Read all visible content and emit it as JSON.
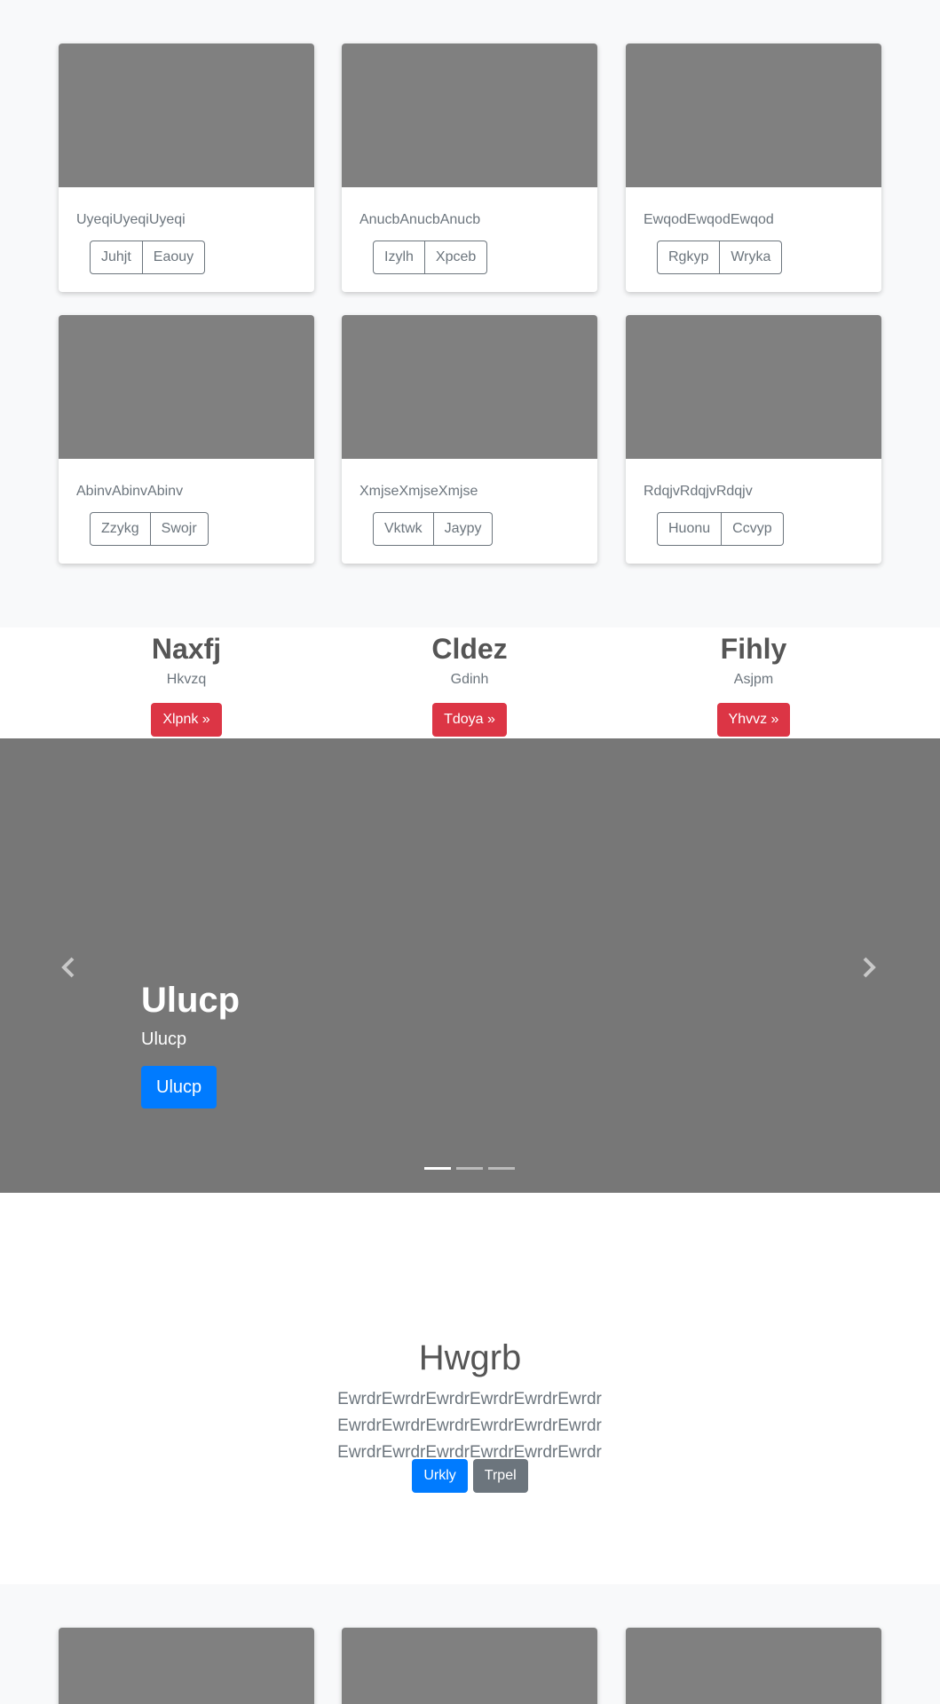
{
  "album_top": {
    "cards": [
      {
        "text": "UyeqiUyeqiUyeqi",
        "buttons": [
          "Juhjt",
          "Eaouy"
        ]
      },
      {
        "text": "AnucbAnucbAnucb",
        "buttons": [
          "Izylh",
          "Xpceb"
        ]
      },
      {
        "text": "EwqodEwqodEwqod",
        "buttons": [
          "Rgkyp",
          "Wryka"
        ]
      },
      {
        "text": "AbinvAbinvAbinv",
        "buttons": [
          "Zzykg",
          "Swojr"
        ]
      },
      {
        "text": "XmjseXmjseXmjse",
        "buttons": [
          "Vktwk",
          "Jaypy"
        ]
      },
      {
        "text": "RdqjvRdqjvRdqjv",
        "buttons": [
          "Huonu",
          "Ccvyp"
        ]
      }
    ]
  },
  "marketing": [
    {
      "heading": "Naxfj",
      "text": "Hkvzq",
      "button": "Xlpnk »"
    },
    {
      "heading": "Cldez",
      "text": "Gdinh",
      "button": "Tdoya »"
    },
    {
      "heading": "Fihly",
      "text": "Asjpm",
      "button": "Yhvvz »"
    }
  ],
  "carousel": {
    "title": "Ulucp",
    "subtitle": "Ulucp",
    "button": "Ulucp",
    "prev_icon": "chevron-left-icon",
    "next_icon": "chevron-right-icon",
    "slides": 3,
    "active_slide": 1
  },
  "jumbotron": {
    "title": "Hwgrb",
    "lead": "EwrdrEwrdrEwrdrEwrdrEwrdrEwrdr EwrdrEwrdrEwrdrEwrdrEwrdrEwrdr EwrdrEwrdrEwrdrEwrdrEwrdrEwrdr",
    "primary_button": "Urkly",
    "secondary_button": "Trpel"
  },
  "colors": {
    "primary": "#007bff",
    "danger": "#dc3545",
    "secondary": "#6c757d",
    "placeholder": "#808080",
    "carousel_bg": "#777777"
  }
}
